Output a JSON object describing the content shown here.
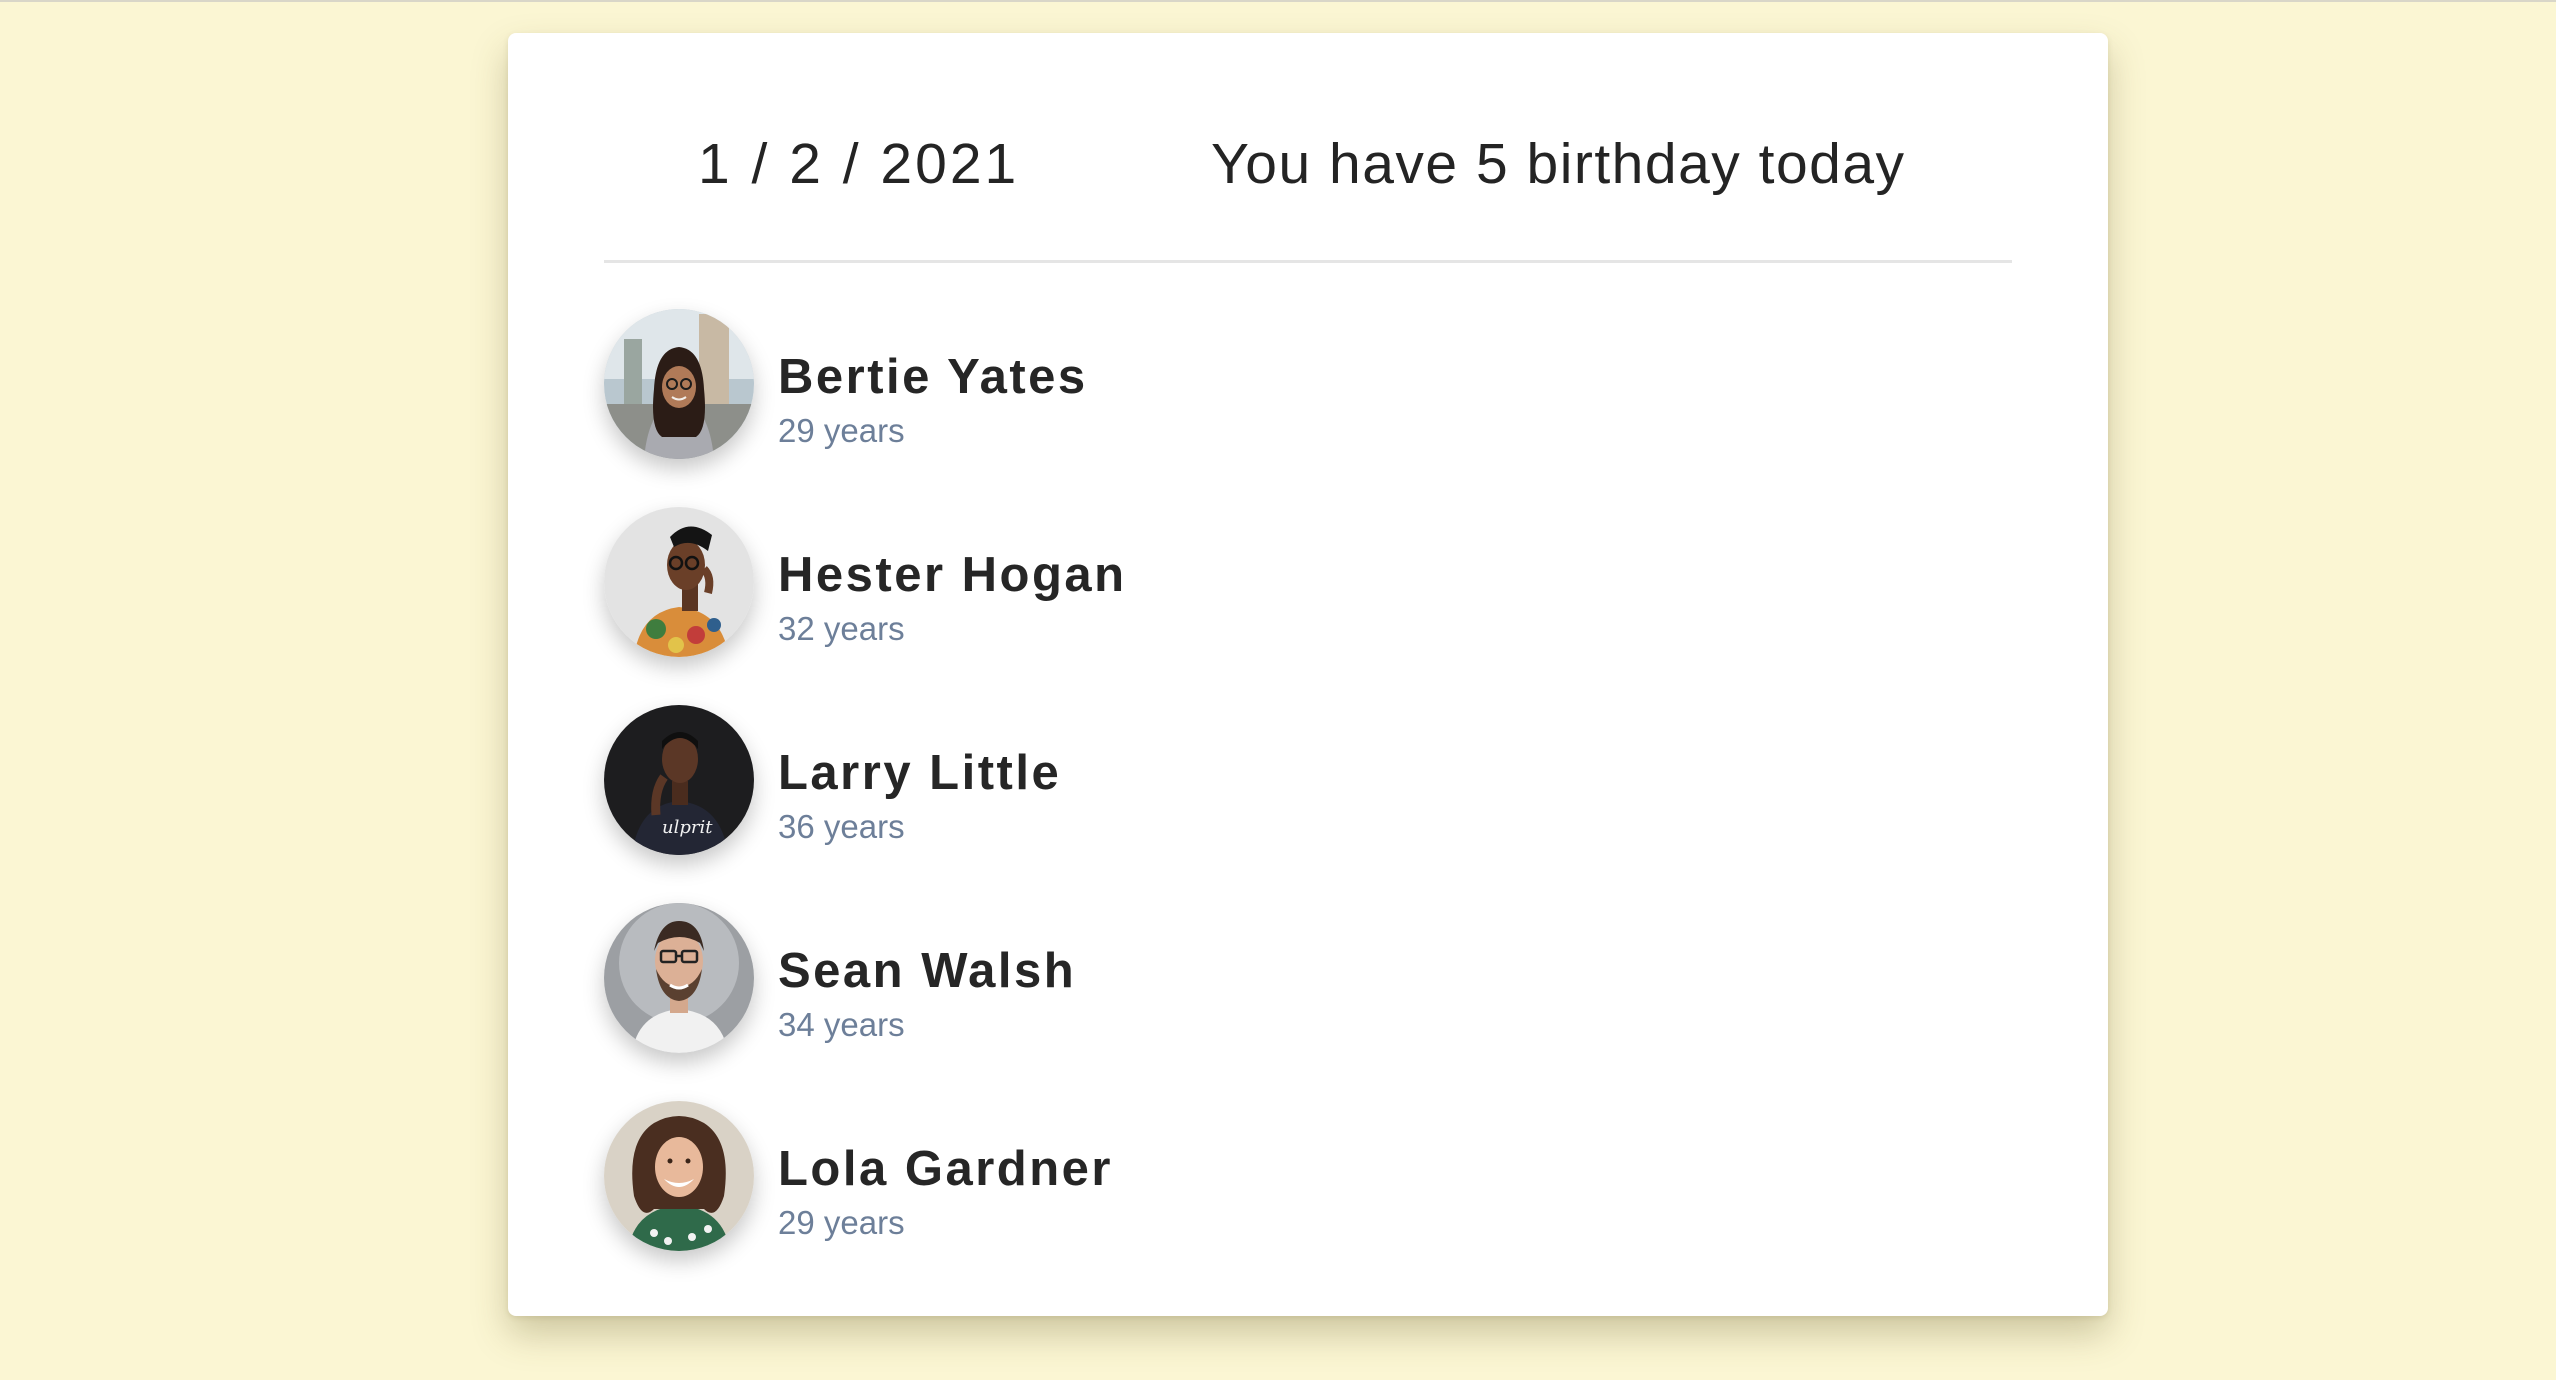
{
  "header": {
    "date": "1 / 2 / 2021",
    "headline": "You have 5 birthday today"
  },
  "people": [
    {
      "name": "Bertie Yates",
      "age": "29 years",
      "avatar": "woman-glasses-street-avatar"
    },
    {
      "name": "Hester Hogan",
      "age": "32 years",
      "avatar": "woman-glasses-floral-avatar"
    },
    {
      "name": "Larry Little",
      "age": "36 years",
      "avatar": "man-dark-tshirt-avatar"
    },
    {
      "name": "Sean Walsh",
      "age": "34 years",
      "avatar": "man-beard-glasses-avatar"
    },
    {
      "name": "Lola Gardner",
      "age": "29 years",
      "avatar": "woman-curly-hair-avatar"
    }
  ],
  "colors": {
    "background": "#fbf6d3",
    "card": "#ffffff",
    "text": "#242424",
    "age_text": "#6d7f99"
  }
}
